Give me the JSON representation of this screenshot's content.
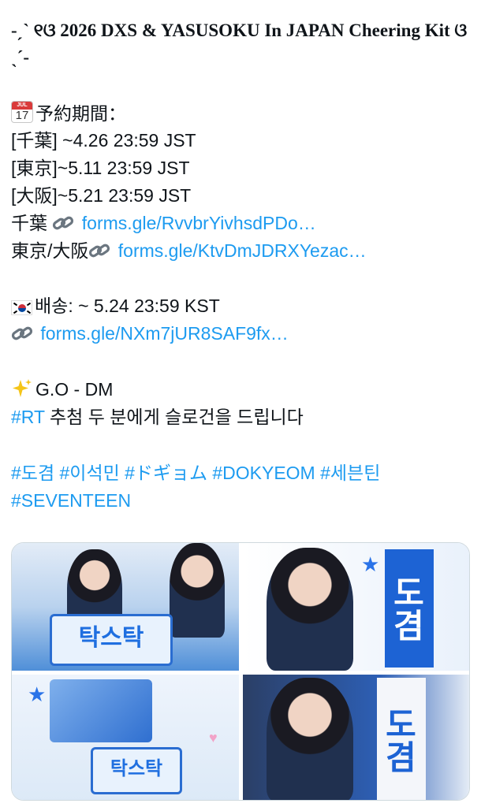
{
  "tweet": {
    "title": "-ˏˋ ୧ଓ 2026 DXS & YASUSOKU In JAPAN Cheering Kit ଓ ˎˊ-",
    "reservation_label": "予約期間：",
    "periods": [
      "[千葉] ~4.26 23:59 JST",
      "[東京]~5.11 23:59 JST",
      "[大阪]~5.21 23:59 JST"
    ],
    "chiba_prefix": "千葉",
    "chiba_link": "forms.gle/RvvbrYivhsdPDo…",
    "tokyo_osaka_prefix": "東京/大阪",
    "tokyo_osaka_link": "forms.gle/KtvDmJDRXYezac…",
    "shipping": "배송: ~ 5.24 23:59 KST",
    "shipping_link": "forms.gle/NXm7jUR8SAF9fx…",
    "go_dm": "G.O - DM",
    "rt_hashtag": "#RT",
    "rt_text": "추첨 두 분에게 슬로건을 드립니다",
    "hashtags_line1": "#도겸 #이석민  #ドギョム #DOKYEOM #세븐틴",
    "hashtags_line2": "#SEVENTEEN",
    "calendar_month": "JUL",
    "calendar_day": "17"
  },
  "media": {
    "banner_text": "탁스탁",
    "slogan_text": "도겸",
    "keychain_text": "탁스탁"
  },
  "colors": {
    "link": "#1d9bf0",
    "text": "#0f1419",
    "accent_blue": "#1d63d4"
  },
  "icons": [
    "calendar-icon",
    "link-icon",
    "korea-flag-icon",
    "sparkles-icon"
  ]
}
